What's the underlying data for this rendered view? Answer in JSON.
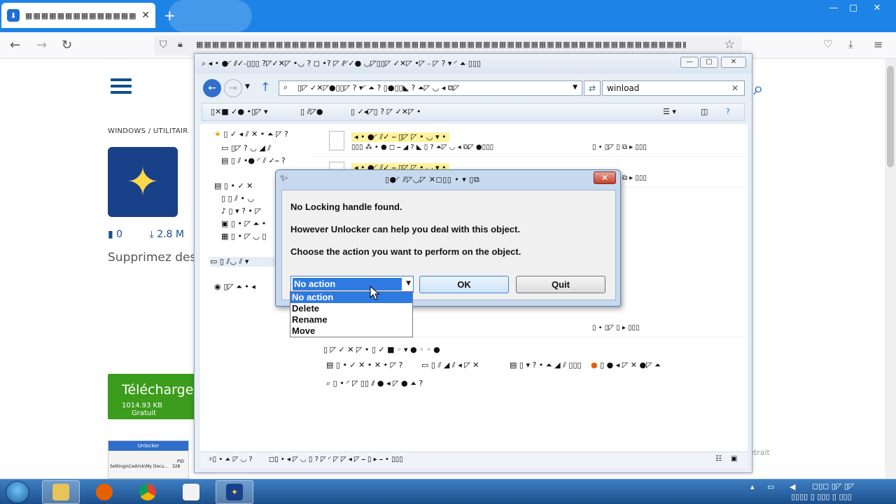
{
  "browser": {
    "tab_title": "▦▦▦▦▦▦▦▦▦▦▦▦▦▦▦▦▦",
    "tab_close": "✕",
    "new_tab": "+",
    "url": "▦▦▦▦▦▦▦▦▦▦▦▦▦▦▦▦▦▦▦▦▦▦▦▦▦▦▦▦▦▦▦▦▦▦▦▦▦▦▦▦▦▦▦▦▦▦▦▦▦▦▦▦▦▦▦▦▦▦▦▦▦▦▦▦▦▦▦▦▦▦▦▦▦▦▦▦▦▦▦▦▦▦"
  },
  "webpage": {
    "breadcrumb": "WINDOWS   /   UTILITAIR",
    "comments_count": "0",
    "downloads_count": "2.8 M",
    "description": "Supprimez des",
    "download_button": "Télécharge",
    "download_size": "1014.93 KB",
    "download_license": "Gratuit",
    "thumb_title": "Unlocker",
    "thumb_pid_label": "PID",
    "thumb_path": "Settings\\Cedrick\\My Docu...",
    "thumb_pid": "328",
    "side_text": "etrait"
  },
  "explorer": {
    "title": "⌕ ◂ • ●◜ ⫽✓⎯▯▯▯ ?◸✓✕◸ •◡ ? ◻ •? ◸ ⫽◜✓● ◡◸▯▯◸ ✓✕◸ •◸ ⎯ ◸ ? ▾ ◜ ⏶ ▯▯▯",
    "address": "▯◸ ✓✕◸●▯▯◸ ? ▾◜ ⏶ ? ▯●▯▯◣ ? ⏶◸ ◡ ◂ ⧉◸",
    "search_value": "winload",
    "search_clear": "✕",
    "cmd_organize": "▯✕■ ✓● •▯◸ ▾",
    "cmd_open": "▯ ⫽◸●",
    "cmd_share": "▯ ✓◂◸▯ ? ◸ ✓✕◸ •",
    "nav": [
      "▯ ✓ ◂ ⫽ ✕ • ⏶ ◸ ?",
      "▯◸ ? ◡ ◢ ⫽",
      "▯ ⫽ •● ◜ ⫽ ✓⎯ ?",
      "▯ • ✓ ✕",
      "▯ ⫽ • ◡",
      "▯ ▾ ? • ◸",
      "▯ • ◸ ⏶ •",
      "▯ • ◸ ◡ ▯",
      "▯ ⫽◡ ⫽ ▾",
      "▯◸ ⏶ • ◂"
    ],
    "files": [
      {
        "name": "◂ • ●◜ ⫽✓ ⎯ ▯◸ ◸ • ◡ ▾ •",
        "sub": "▯▯▯ ⁂ • ● ◻ ⎯ ◢ ? ◣ ▯ ? ⏶◸ ◡ ◂ ⧉◸ ●▯▯▯",
        "right": "▯ • ▯◸ ▯ ⧉ ▸ ▯▯▯"
      },
      {
        "name": "◂ • ●◜ ⫽✓ ⎯ ▯◸ ◸ • ◡ ▾ •",
        "sub": "▯▯▯ ⁂ • ● ◻ ⎯ ◢ ?",
        "right": "▯ • ▯◸ ▯ ⧉ ▸ ▯▯▯"
      },
      {
        "name": "▯ ◸ ⎯ ▯◸ ●",
        "sub": "▯ ◣ ? ◂ ◸ ◡ ◂ ⧉",
        "right": "▯ • ▯◸ ▯ ▸ ▯▯▯"
      }
    ],
    "extra_line": "▯ ◸ ✓ ✕ ◸ • ▯ ✓ ■ ◦ ▾ ● ◦ ◦ ●",
    "libs": [
      "▯ • ✓ ✕ • ✕ • ◸ ?",
      "▯ ⫽ ◢ ⫽ ◂ ◸ ✕",
      "▯ ▾ ? • ⏶ ◢ ⫽ ▯▯▯",
      "▯ ● ◂ ◸ ✕ ●◸ ⏶"
    ],
    "libs2": "▯ • ◜ ◸ ▯▯ ⫽ ● ◂ ◸ ● ⏶ ?",
    "status_left": "⩡▯ • ⏶ ◸ ◡ ?",
    "status_mid": "◻▯ • ◂ ◸ ◡ ▯ ? ◸ ◜ ◸ ◸ ◂ ◸ ⎯ ▯ ▸ ⎯ • ▯▯▯"
  },
  "dialog": {
    "title": "▯●◜ ⫽◸◡◸ ✕◻▯▯ • ▾ ▯⧉",
    "close": "✕",
    "message1": "No Locking handle found.",
    "message2": "However Unlocker can help you deal with this object.",
    "message3": "Choose the action you want to perform on the object.",
    "action_value": "No action",
    "ok_label": "OK",
    "quit_label": "Quit",
    "options": [
      "No action",
      "Delete",
      "Rename",
      "Move"
    ]
  },
  "taskbar": {
    "tray_time": "◻▯◻ ▯◸ ▯◸",
    "tray_date": "▯▯▯▯ ▯ ▯▯▯ ▯ ▯▯▯"
  },
  "colors": {
    "browser_accent": "#1d83e6",
    "download_green": "#3c9c1c",
    "selection_blue": "#2f7ae0",
    "taskbar": "#1c4f8c"
  }
}
